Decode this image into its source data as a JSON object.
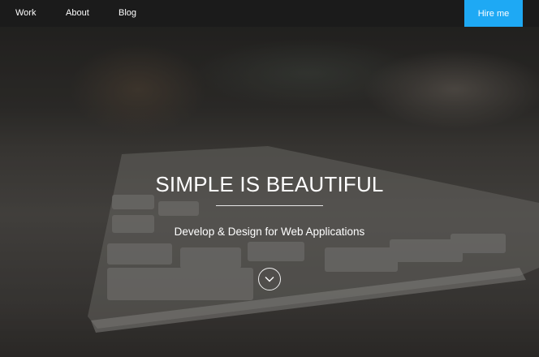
{
  "nav": {
    "items": [
      {
        "label": "Work"
      },
      {
        "label": "About"
      },
      {
        "label": "Blog"
      }
    ],
    "cta_label": "Hire me",
    "cta_color": "#1ea9f4"
  },
  "hero": {
    "title": "SIMPLE IS BEAUTIFUL",
    "subtitle": "Develop & Design for Web Applications",
    "scroll_icon": "chevron-down-circle-icon"
  }
}
